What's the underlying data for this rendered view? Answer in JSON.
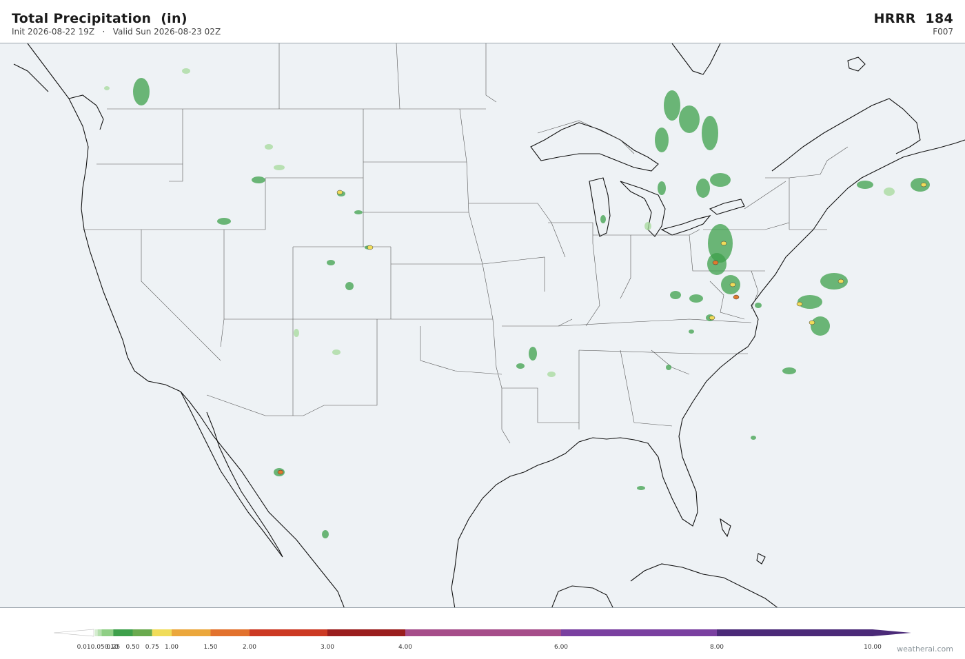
{
  "header": {
    "title": "Total Precipitation  (in)",
    "subtitle": "Init 2026-08-22 19Z   ·   Valid Sun 2026-08-23 02Z",
    "model": "HRRR  184",
    "frame": "F007"
  },
  "colors": {
    "background": "#ffffff",
    "map_fill": "#eef2f5",
    "coastline": "#111111",
    "state_lines": "#555555",
    "precip_light": "#a6d99b",
    "precip_mid": "#3ea04b",
    "precip_heavy": "#f0dc5a",
    "precip_max": "#e07a2e"
  },
  "colorbar": {
    "ticks": [
      "0.01",
      "0.05",
      "0.10",
      "0.25",
      "0.50",
      "0.75",
      "1.00",
      "1.50",
      "2.00",
      "3.00",
      "4.00",
      "6.00",
      "8.00",
      "10.00"
    ],
    "tick_labels_rendered": [
      "0.010.050.10",
      "0.25",
      "0.50",
      "0.75",
      "1.00",
      "1.50",
      "2.00",
      "3.00",
      "4.00",
      "6.00",
      "8.00",
      "10.00"
    ],
    "bins": [
      {
        "from": 0.0,
        "to": 0.01,
        "color": "#ffffff"
      },
      {
        "from": 0.01,
        "to": 0.05,
        "color": "#d5ecd0"
      },
      {
        "from": 0.05,
        "to": 0.1,
        "color": "#b5dfae"
      },
      {
        "from": 0.1,
        "to": 0.25,
        "color": "#8fcf85"
      },
      {
        "from": 0.25,
        "to": 0.5,
        "color": "#3ea04b"
      },
      {
        "from": 0.5,
        "to": 0.75,
        "color": "#6aaa4f"
      },
      {
        "from": 0.75,
        "to": 1.0,
        "color": "#f0dc5a"
      },
      {
        "from": 1.0,
        "to": 1.5,
        "color": "#eba73c"
      },
      {
        "from": 1.5,
        "to": 2.0,
        "color": "#e2722e"
      },
      {
        "from": 2.0,
        "to": 3.0,
        "color": "#cc3a24"
      },
      {
        "from": 3.0,
        "to": 4.0,
        "color": "#9a1e1e"
      },
      {
        "from": 4.0,
        "to": 6.0,
        "color": "#a64d8a"
      },
      {
        "from": 6.0,
        "to": 8.0,
        "color": "#7a40a0"
      },
      {
        "from": 8.0,
        "to": 10.0,
        "color": "#4b2a78"
      }
    ]
  },
  "watermark": "weatherai.com"
}
